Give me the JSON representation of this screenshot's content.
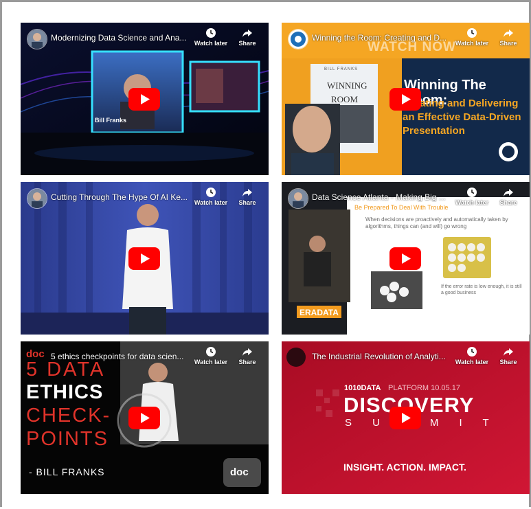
{
  "videos": [
    {
      "title": "Modernizing Data Science and Ana...",
      "watch_later": "Watch later",
      "share": "Share"
    },
    {
      "title": "Winning the Room: Creating and D...",
      "watch_later": "Watch later",
      "share": "Share",
      "overlay": "WATCH NOW",
      "book_top": "BILL FRANKS",
      "book_title_1": "WINNING",
      "book_title_2": "ROOM",
      "headline_1": "Winning The Room:",
      "headline_2": "Creating and Delivering",
      "headline_3": "an Effective Data-Driven",
      "headline_4": "Presentation"
    },
    {
      "title": "Cutting Through The Hype Of AI Ke...",
      "watch_later": "Watch later",
      "share": "Share"
    },
    {
      "title": "Data Science Atlanta - Making Big ...",
      "watch_later": "Watch later",
      "share": "Share",
      "slide_heading": "Be Prepared To Deal With Trouble",
      "slide_text": "When decisions are proactively and automatically taken by algorithms, things can (and will) go wrong",
      "logo": "ERADATA",
      "corner_text": "If the error rate is low enough, it is still a good business"
    },
    {
      "title": "5 ethics checkpoints for data scien...",
      "watch_later": "Watch later",
      "share": "Share",
      "logo": "doc",
      "line_1": "5 DATA",
      "line_2": "ETHICS",
      "line_3": "CHECK-",
      "line_4": "POINTS",
      "byline": "- BILL FRANKS"
    },
    {
      "title": "The Industrial Revolution of Analyti...",
      "watch_later": "Watch later",
      "share": "Share",
      "brand": "1010DATA",
      "platform": "PLATFORM 10.05.17",
      "big": "DISCOVERY",
      "summit": "S U M M I T",
      "tagline": "INSIGHT.  ACTION.  IMPACT."
    }
  ],
  "colors": {
    "play_red": "#ff0000",
    "winning_orange": "#f5a623",
    "winning_navy": "#12294a",
    "ethics_red": "#e0332a",
    "discovery_red": "#c8102e"
  },
  "icons": [
    "clock-icon",
    "share-arrow-icon",
    "play-button-icon"
  ]
}
